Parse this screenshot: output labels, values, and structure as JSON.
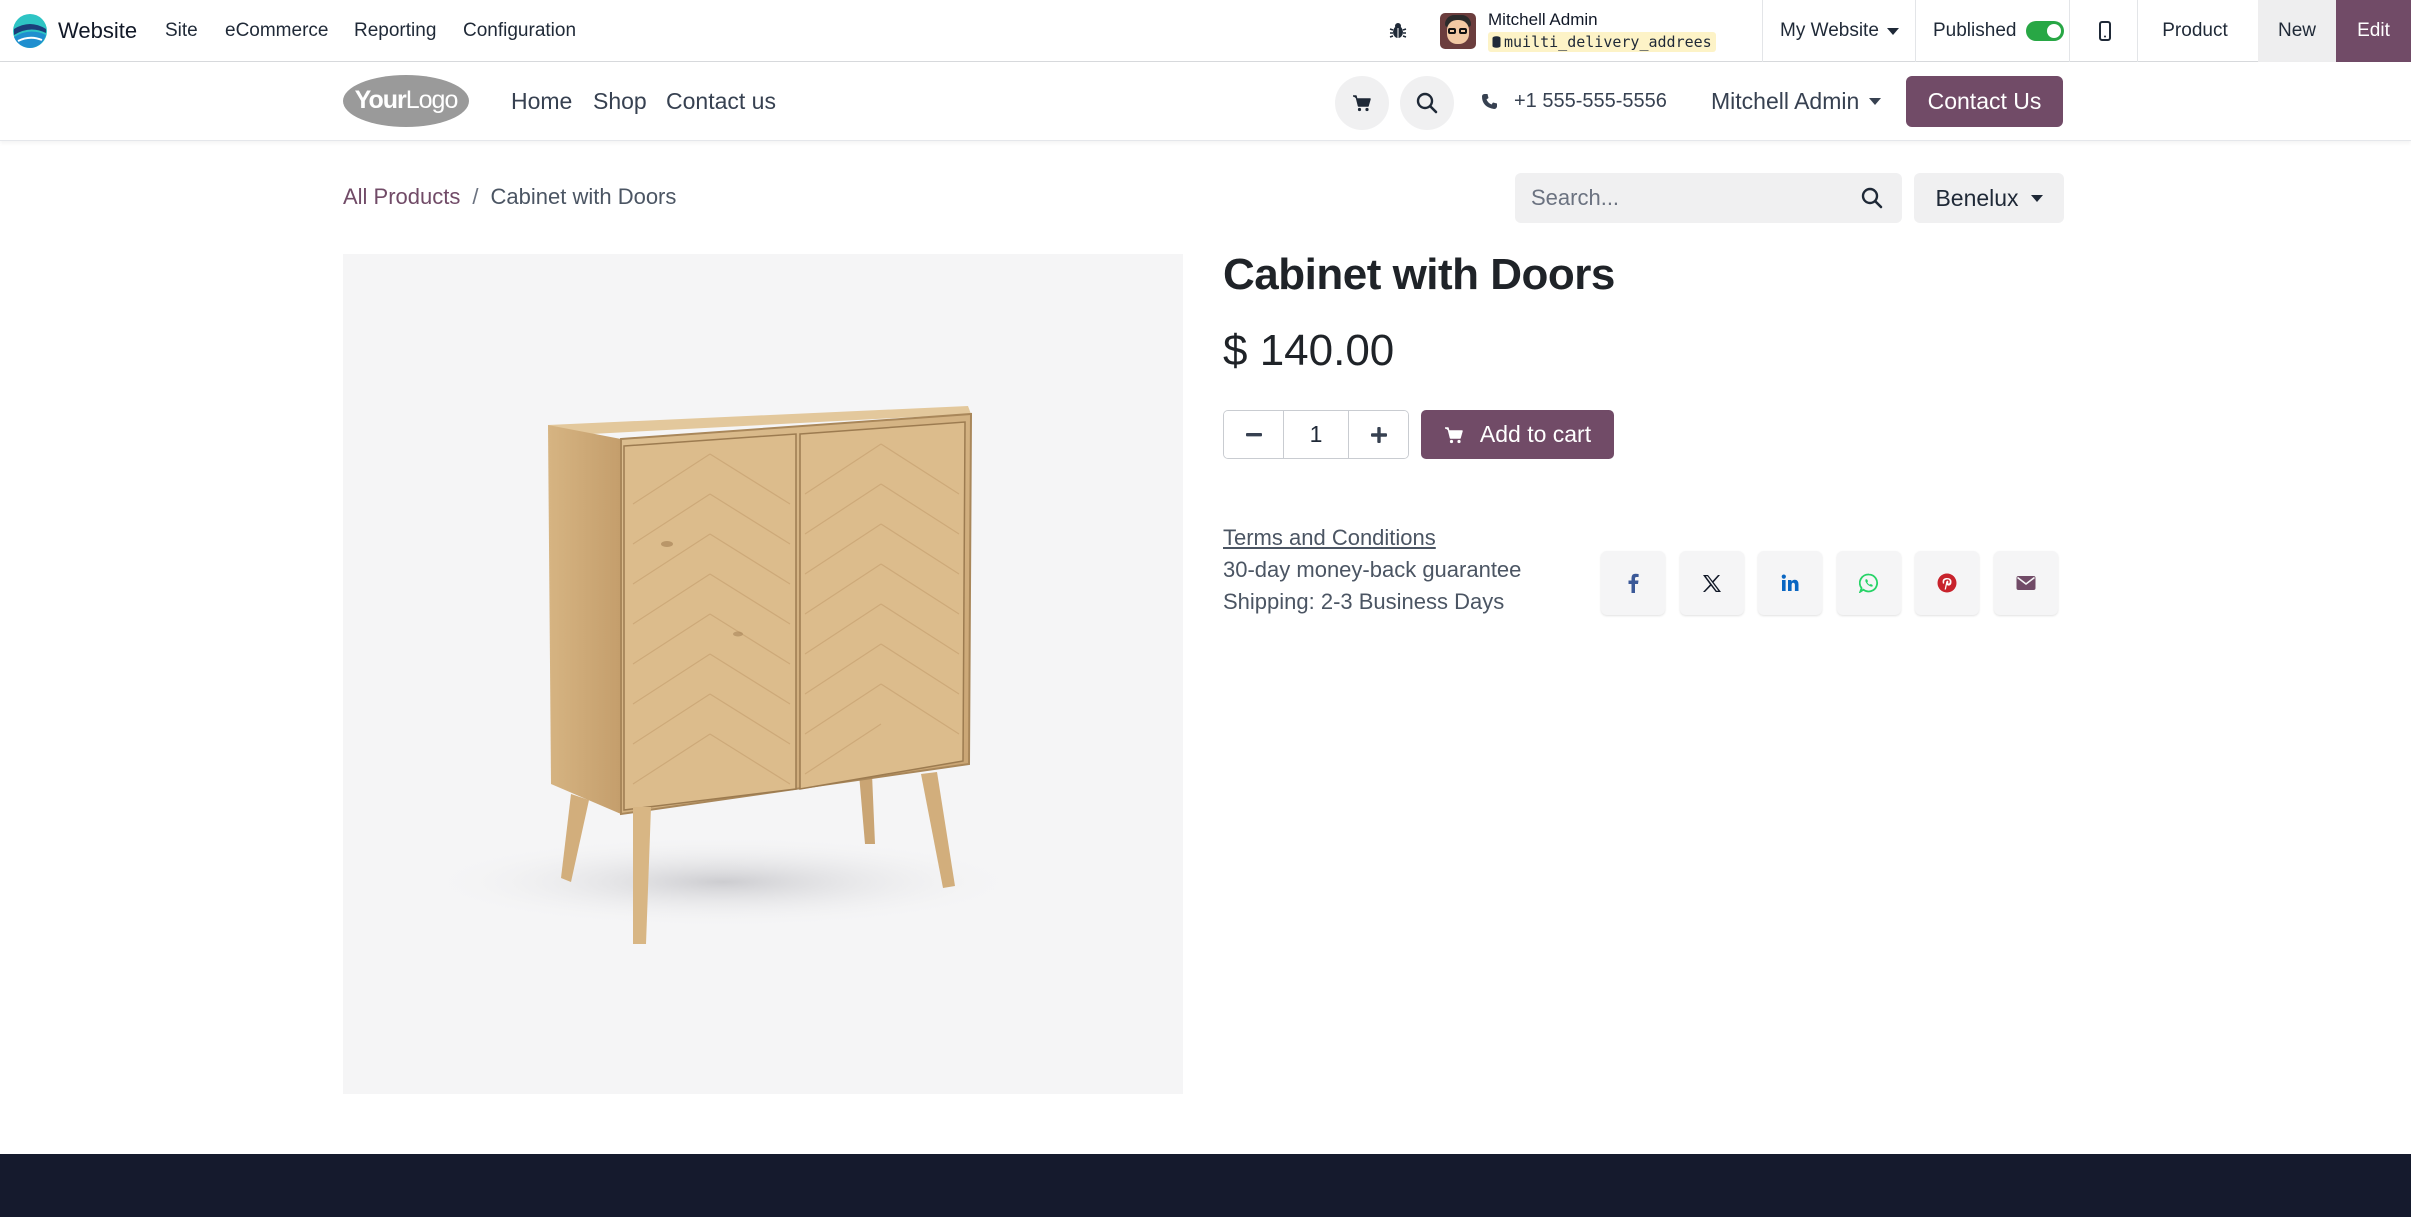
{
  "admin_bar": {
    "app_name": "Website",
    "menu": [
      "Site",
      "eCommerce",
      "Reporting",
      "Configuration"
    ],
    "user_name": "Mitchell Admin",
    "database": "muilti_delivery_addrees",
    "website_selector": "My Website",
    "published_label": "Published",
    "published": true,
    "product_label": "Product",
    "new_label": "New",
    "edit_label": "Edit"
  },
  "site_header": {
    "logo_text": "YourLogo",
    "nav": [
      "Home",
      "Shop",
      "Contact us"
    ],
    "phone": "+1 555-555-5556",
    "user_menu": "Mitchell Admin",
    "contact_button": "Contact Us"
  },
  "breadcrumb": {
    "parent": "All Products",
    "separator": "/",
    "current": "Cabinet with Doors"
  },
  "search": {
    "placeholder": "Search..."
  },
  "pricelist": "Benelux",
  "product": {
    "name": "Cabinet with Doors",
    "price": "$ 140.00",
    "quantity": "1",
    "add_to_cart": "Add to cart",
    "terms": "Terms and Conditions",
    "guarantee": "30-day money-back guarantee",
    "shipping": "Shipping: 2-3 Business Days"
  },
  "share_icons": [
    "facebook-icon",
    "x-twitter-icon",
    "linkedin-icon",
    "whatsapp-icon",
    "pinterest-icon",
    "email-icon"
  ],
  "colors": {
    "brand": "#714b67",
    "published_toggle": "#28a745",
    "footer": "#151a2d",
    "whatsapp": "#25d366",
    "pinterest": "#c8232c",
    "facebook": "#3b5998",
    "linkedin": "#0a66c2"
  }
}
